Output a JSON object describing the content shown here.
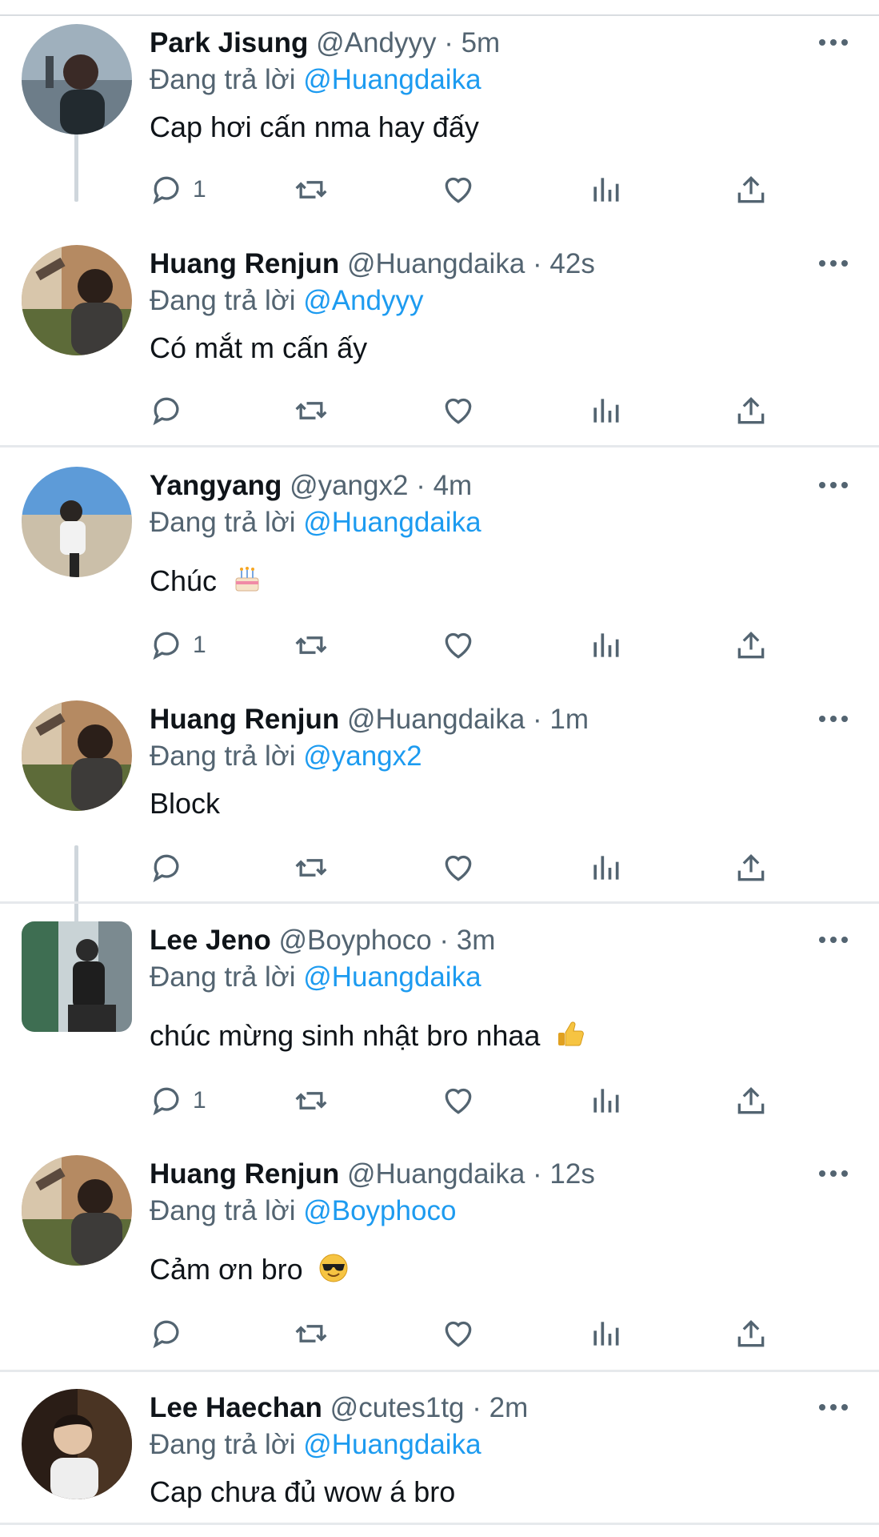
{
  "reply_prefix": "Đang trả lời",
  "colors": {
    "mention": "#1d9bf0",
    "secondary": "#536471",
    "divider": "#e6e9ec"
  },
  "tweets": [
    {
      "name": "Park Jisung",
      "handle": "@Andyyy",
      "sep": "·",
      "time": "5m",
      "reply_to": "@Huangdaika",
      "text": "Cap hơi cấn nma hay đấy",
      "reply_count": "1",
      "emoji": ""
    },
    {
      "name": "Huang Renjun",
      "handle": "@Huangdaika",
      "sep": "·",
      "time": "42s",
      "reply_to": "@Andyyy",
      "text": "Có mắt m cấn ấy",
      "reply_count": "",
      "emoji": ""
    },
    {
      "name": "Yangyang",
      "handle": "@yangx2",
      "sep": "·",
      "time": "4m",
      "reply_to": "@Huangdaika",
      "text": "Chúc",
      "reply_count": "1",
      "emoji": "cake-emoji"
    },
    {
      "name": "Huang Renjun",
      "handle": "@Huangdaika",
      "sep": "·",
      "time": "1m",
      "reply_to": "@yangx2",
      "text": "Block",
      "reply_count": "",
      "emoji": ""
    },
    {
      "name": "Lee Jeno",
      "handle": "@Boyphoco",
      "sep": "·",
      "time": "3m",
      "reply_to": "@Huangdaika",
      "text": "chúc mừng sinh nhật bro nhaa",
      "reply_count": "1",
      "emoji": "thumbs-up-emoji"
    },
    {
      "name": "Huang Renjun",
      "handle": "@Huangdaika",
      "sep": "·",
      "time": "12s",
      "reply_to": "@Boyphoco",
      "text": "Cảm ơn bro",
      "reply_count": "",
      "emoji": "sunglasses-emoji"
    },
    {
      "name": "Lee Haechan",
      "handle": "@cutes1tg",
      "sep": "·",
      "time": "2m",
      "reply_to": "@Huangdaika",
      "text": "Cap chưa đủ wow á bro",
      "reply_count": "",
      "emoji": ""
    }
  ]
}
